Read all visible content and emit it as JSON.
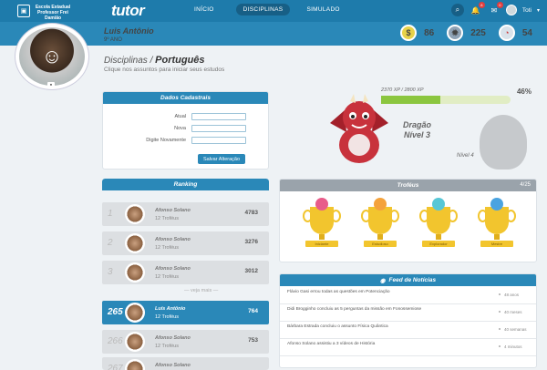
{
  "topbar": {
    "school_name": "Escola Estadual Professor Frei Damião",
    "brand": "tutor",
    "nav": [
      {
        "label": "INÍCIO"
      },
      {
        "label": "DISCIPLINAS"
      },
      {
        "label": "SIMULADO"
      }
    ],
    "notif_count": "8",
    "msg_count": "0",
    "user": "Toti"
  },
  "profile": {
    "name": "Luis Antônio",
    "grade": "9º ANO",
    "stats": [
      {
        "icon": "coin-icon",
        "value": "86",
        "color": "#e7d24a"
      },
      {
        "icon": "bomb-icon",
        "value": "225",
        "color": "#8fa3b6"
      },
      {
        "icon": "speed-icon",
        "value": "54",
        "color": "#d9e2ea"
      }
    ]
  },
  "breadcrumb": {
    "prefix": "Disciplinas /",
    "current": "Português"
  },
  "subtitle": "Clique nos assuntos para iniciar seus estudos",
  "dados": {
    "title": "Dados Cadastrais",
    "fields": [
      {
        "label": "Atual"
      },
      {
        "label": "Nova"
      },
      {
        "label": "Digite Novamente"
      }
    ],
    "save": "Salvar Alteração"
  },
  "dragon": {
    "xp": "2370 XP / 2800 XP",
    "xp_percent": 46,
    "xp_percent_text": "46%",
    "name": "Dragão",
    "level": "Nível 3",
    "next_level": "Nível 4"
  },
  "ranking": {
    "title": "Ranking",
    "rows": [
      {
        "pos": "1",
        "name": "Afonso Solano",
        "trophies": "12 Troféus",
        "points": "4783"
      },
      {
        "pos": "2",
        "name": "Afonso Solano",
        "trophies": "12 Troféus",
        "points": "3276"
      },
      {
        "pos": "3",
        "name": "Afonso Solano",
        "trophies": "12 Troféus",
        "points": "3012"
      }
    ],
    "see_more": "— veja mais —",
    "me": {
      "pos": "265",
      "name": "Luís Antônio",
      "trophies": "12 Troféus",
      "points": "764"
    },
    "after": [
      {
        "pos": "266",
        "name": "Afonso Solano",
        "trophies": "12 Troféus",
        "points": "753"
      },
      {
        "pos": "267",
        "name": "Afonso Solano",
        "trophies": "",
        "points": ""
      }
    ]
  },
  "trofeus": {
    "title": "Troféus",
    "count": "4/25",
    "items": [
      {
        "label": "Iniciante",
        "mascot": "#e85c8a"
      },
      {
        "label": "Estudioso",
        "mascot": "#f4a23c"
      },
      {
        "label": "Explorador",
        "mascot": "#57c7d6"
      },
      {
        "label": "Mestre",
        "mascot": "#4aa3e0"
      }
    ]
  },
  "feed": {
    "title": "Feed de Notícias",
    "items": [
      {
        "text": "Flávio Gasi errou todas as questões em Potenciação",
        "time": "48 anos"
      },
      {
        "text": "Didi Brogginho concluiu as 5 perguntas da missão em Fonossemiose",
        "time": "40 meses"
      },
      {
        "text": "Bárbara Estrada concluiu o assunto Física Quântica",
        "time": "40 semanas"
      },
      {
        "text": "Afonso Solano assistiu a 3 vídeos de História",
        "time": "4 minutos"
      }
    ]
  }
}
